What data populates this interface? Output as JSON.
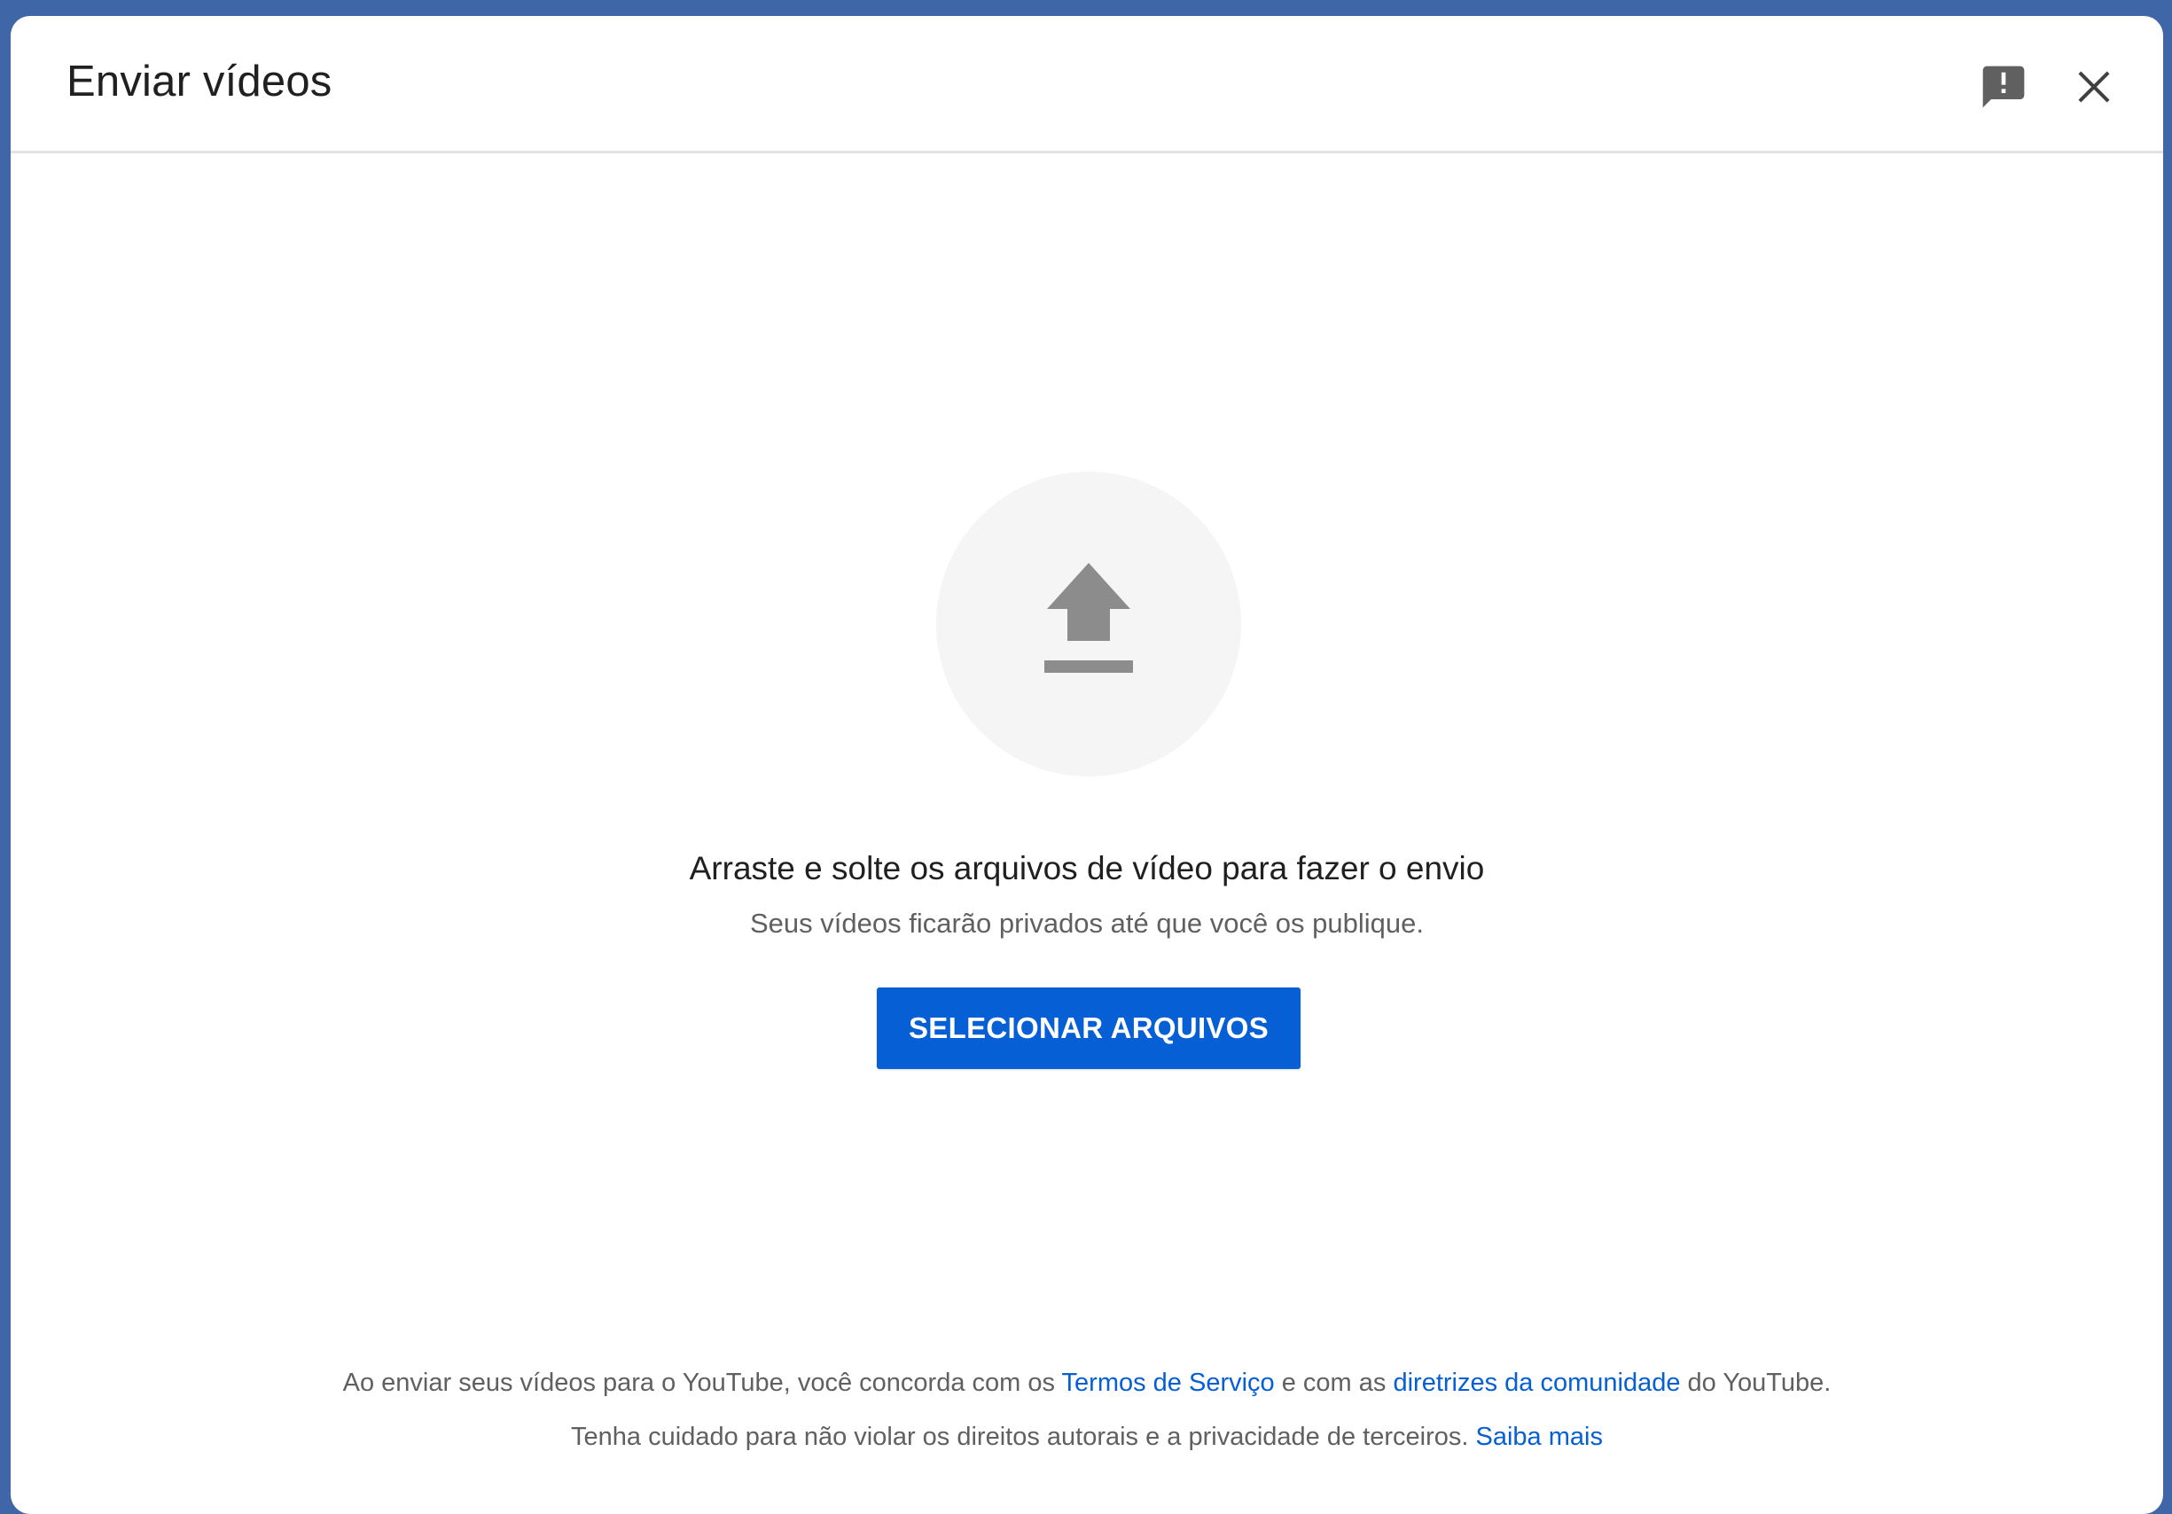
{
  "colors": {
    "accent": "#065fd4",
    "background": "#3f66a6",
    "icon": "#8c8c8c"
  },
  "header": {
    "title": "Enviar vídeos",
    "feedback_icon": "feedback-icon",
    "close_icon": "close-icon"
  },
  "main": {
    "upload_icon": "upload-icon",
    "headline": "Arraste e solte os arquivos de vídeo para fazer o envio",
    "subline": "Seus vídeos ficarão privados até que você os publique.",
    "select_button": "SELECIONAR ARQUIVOS"
  },
  "footer": {
    "line1_prefix": "Ao enviar seus vídeos para o YouTube, você concorda com os ",
    "terms_link": "Termos de Serviço",
    "line1_middle": " e com as ",
    "guidelines_link": "diretrizes da comunidade",
    "line1_suffix": " do YouTube.",
    "line2_text": "Tenha cuidado para não violar os direitos autorais e a privacidade de terceiros. ",
    "learn_more_link": "Saiba mais"
  }
}
